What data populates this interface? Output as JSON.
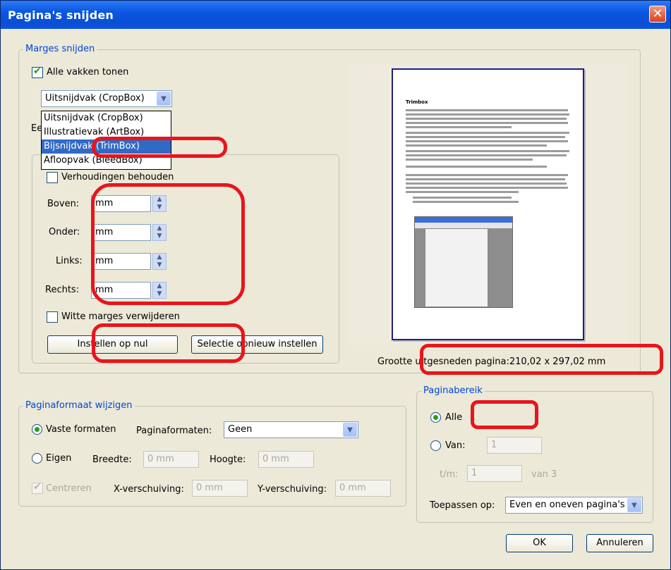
{
  "window": {
    "title": "Pagina's snijden",
    "close_label": "✕"
  },
  "margins": {
    "legend": "Marges snijden",
    "show_all_label": "Alle vakken tonen",
    "box_select_value": "Uitsnijdvak (CropBox)",
    "dropdown_options": [
      "Uitsnijdvak (CropBox)",
      "Illustratievak (ArtBox)",
      "Bijsnijdvak (TrimBox)",
      "Afloopvak (BleedBox)"
    ],
    "hidden_label_fragment": "Ee",
    "keep_ratio_label": "Verhoudingen behouden",
    "top_label": "Boven:",
    "top_value": "mm",
    "bottom_label": "Onder:",
    "bottom_value": "mm",
    "left_label": "Links:",
    "left_value": "mm",
    "right_label": "Rechts:",
    "right_value": "mm",
    "remove_white_label": "Witte marges verwijderen",
    "reset_zero_label": "Instellen op nul",
    "reset_selection_label": "Selectie opnieuw instellen"
  },
  "preview": {
    "doc_heading": "Trimbox",
    "size_label": "Grootte uitgesneden pagina:210,02 x 297,02 mm"
  },
  "page_size": {
    "legend": "Paginaformaat wijzigen",
    "fixed_label": "Vaste formaten",
    "formats_label": "Paginaformaten:",
    "formats_value": "Geen",
    "custom_label": "Eigen",
    "width_label": "Breedte:",
    "width_value": "0 mm",
    "height_label": "Hoogte:",
    "height_value": "0 mm",
    "center_label": "Centreren",
    "xoffset_label": "X-verschuiving:",
    "xoffset_value": "0 mm",
    "yoffset_label": "Y-verschuiving:",
    "yoffset_value": "0 mm"
  },
  "range": {
    "legend": "Paginabereik",
    "all_label": "Alle",
    "from_label": "Van:",
    "from_value": "1",
    "to_label": "t/m:",
    "to_value": "1",
    "of_label": "van 3",
    "apply_label": "Toepassen op:",
    "apply_value": "Even en oneven pagina's"
  },
  "buttons": {
    "ok": "OK",
    "cancel": "Annuleren"
  },
  "colors": {
    "accent": "#0046d5",
    "highlight": "#e8151b",
    "titlebar": "#0b56e0"
  }
}
